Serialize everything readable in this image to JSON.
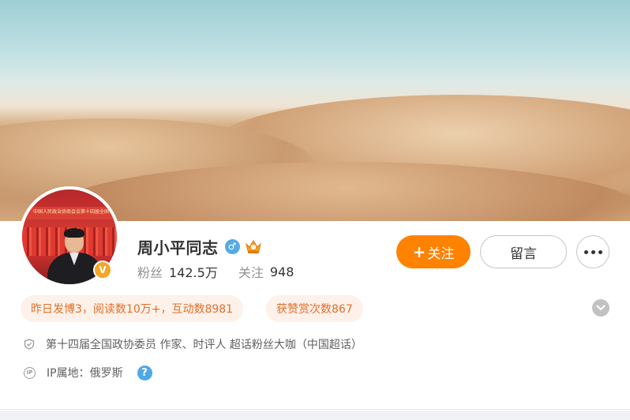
{
  "profile": {
    "name": "周小平同志",
    "avatar_banner_text": "中国人民政治协商会议第十四届全国委员会",
    "verified_badge": "V",
    "gender_symbol": "♂",
    "stats": {
      "fans_label": "粉丝",
      "fans_value": "142.5万",
      "following_label": "关注",
      "following_value": "948"
    }
  },
  "actions": {
    "follow_plus": "+",
    "follow_label": "关注",
    "message_label": "留言"
  },
  "highlights": {
    "activity": "昨日发博3，阅读数10万+，互动数8981",
    "rewards": "获赞赏次数867"
  },
  "info": {
    "description": "第十四届全国政协委员 作家、时评人 超话粉丝大咖（中国超话）",
    "ip_icon_text": "IP",
    "ip_location": "IP属地：俄罗斯",
    "help_symbol": "?"
  },
  "colors": {
    "accent": "#ff8200",
    "pill_bg": "#fdf1ea",
    "pill_text": "#e0702a",
    "gender_blue": "#57a9e3",
    "verified_gold": "#f5a623"
  },
  "icons": {
    "verified": "verified-v-icon",
    "gender": "male-gender-icon",
    "crown": "fan-crown-icon",
    "more": "more-dots-icon",
    "chevron": "chevron-down-icon",
    "shield": "shield-check-icon",
    "ip": "ip-location-icon",
    "help": "help-question-icon"
  }
}
